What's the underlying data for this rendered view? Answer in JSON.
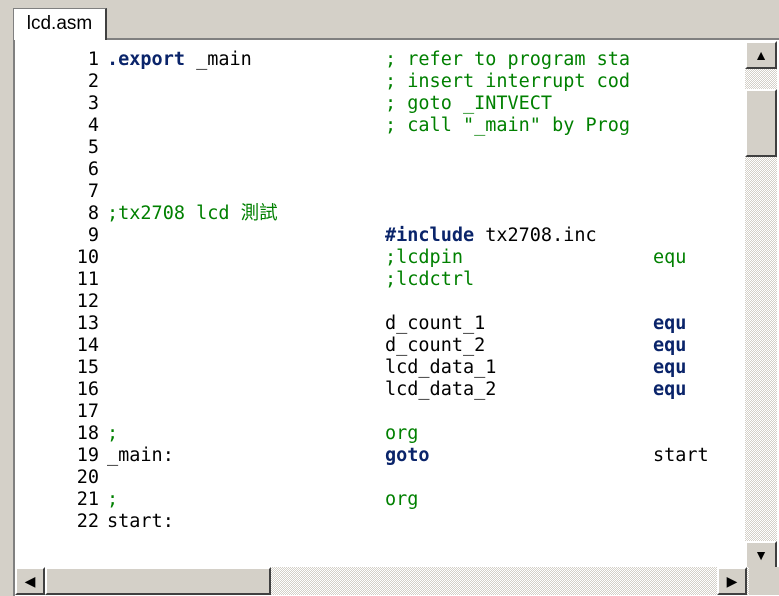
{
  "tab": {
    "label": "lcd.asm"
  },
  "icons": {
    "scroll_up": "▲",
    "scroll_down": "▼",
    "scroll_left": "◀",
    "scroll_right": "▶"
  },
  "colors": {
    "keyword": "#0a246a",
    "comment": "#008000",
    "plain": "#000000"
  },
  "lines": [
    {
      "n": "1",
      "c1": ".export _main",
      "c1cls": "mixed-export",
      "c2": "; refer to program sta",
      "c2cls": "cm",
      "c3": "",
      "c3cls": ""
    },
    {
      "n": "2",
      "c1": "",
      "c1cls": "",
      "c2": "; insert interrupt cod",
      "c2cls": "cm",
      "c3": "",
      "c3cls": ""
    },
    {
      "n": "3",
      "c1": "",
      "c1cls": "",
      "c2": "; goto _INTVECT",
      "c2cls": "cm",
      "c3": "",
      "c3cls": ""
    },
    {
      "n": "4",
      "c1": "",
      "c1cls": "",
      "c2": "; call \"_main\" by Prog",
      "c2cls": "cm",
      "c3": "",
      "c3cls": ""
    },
    {
      "n": "5",
      "c1": "",
      "c1cls": "",
      "c2": "",
      "c2cls": "",
      "c3": "",
      "c3cls": ""
    },
    {
      "n": "6",
      "c1": "",
      "c1cls": "",
      "c2": "",
      "c2cls": "",
      "c3": "",
      "c3cls": ""
    },
    {
      "n": "7",
      "c1": "",
      "c1cls": "",
      "c2": "",
      "c2cls": "",
      "c3": "",
      "c3cls": ""
    },
    {
      "n": "8",
      "c1": ";tx2708 lcd 測試",
      "c1cls": "cm",
      "c2": "",
      "c2cls": "",
      "c3": "",
      "c3cls": ""
    },
    {
      "n": "9",
      "c1": "",
      "c1cls": "",
      "c2": "#include tx2708.inc",
      "c2cls": "mixed-include",
      "c3": "",
      "c3cls": ""
    },
    {
      "n": "10",
      "c1": "",
      "c1cls": "",
      "c2": ";lcdpin",
      "c2cls": "cm",
      "c3": "equ",
      "c3cls": "cm"
    },
    {
      "n": "11",
      "c1": "",
      "c1cls": "",
      "c2": ";lcdctrl",
      "c2cls": "cm",
      "c3": "",
      "c3cls": ""
    },
    {
      "n": "12",
      "c1": "",
      "c1cls": "",
      "c2": "",
      "c2cls": "",
      "c3": "",
      "c3cls": ""
    },
    {
      "n": "13",
      "c1": "",
      "c1cls": "",
      "c2": "d_count_1",
      "c2cls": "",
      "c3": "equ",
      "c3cls": "kw"
    },
    {
      "n": "14",
      "c1": "",
      "c1cls": "",
      "c2": "d_count_2",
      "c2cls": "",
      "c3": "equ",
      "c3cls": "kw"
    },
    {
      "n": "15",
      "c1": "",
      "c1cls": "",
      "c2": "lcd_data_1",
      "c2cls": "",
      "c3": "equ",
      "c3cls": "kw"
    },
    {
      "n": "16",
      "c1": "",
      "c1cls": "",
      "c2": "lcd_data_2",
      "c2cls": "",
      "c3": "equ",
      "c3cls": "kw"
    },
    {
      "n": "17",
      "c1": "",
      "c1cls": "",
      "c2": "",
      "c2cls": "",
      "c3": "",
      "c3cls": ""
    },
    {
      "n": "18",
      "c1": ";",
      "c1cls": "cm",
      "c2": "org",
      "c2cls": "cm",
      "c3": "",
      "c3cls": ""
    },
    {
      "n": "19",
      "c1": "_main:",
      "c1cls": "",
      "c2": "goto",
      "c2cls": "kw",
      "c3": "start",
      "c3cls": ""
    },
    {
      "n": "20",
      "c1": "",
      "c1cls": "",
      "c2": "",
      "c2cls": "",
      "c3": "",
      "c3cls": ""
    },
    {
      "n": "21",
      "c1": ";",
      "c1cls": "cm",
      "c2": "org",
      "c2cls": "cm",
      "c3": "",
      "c3cls": ""
    },
    {
      "n": "22",
      "c1": "start:",
      "c1cls": "",
      "c2": "",
      "c2cls": "",
      "c3": "",
      "c3cls": ""
    }
  ],
  "line1_parts": {
    "kw": ".export",
    "rest": " _main"
  },
  "line9_parts": {
    "kw": "#include",
    "rest": " tx2708.inc"
  }
}
